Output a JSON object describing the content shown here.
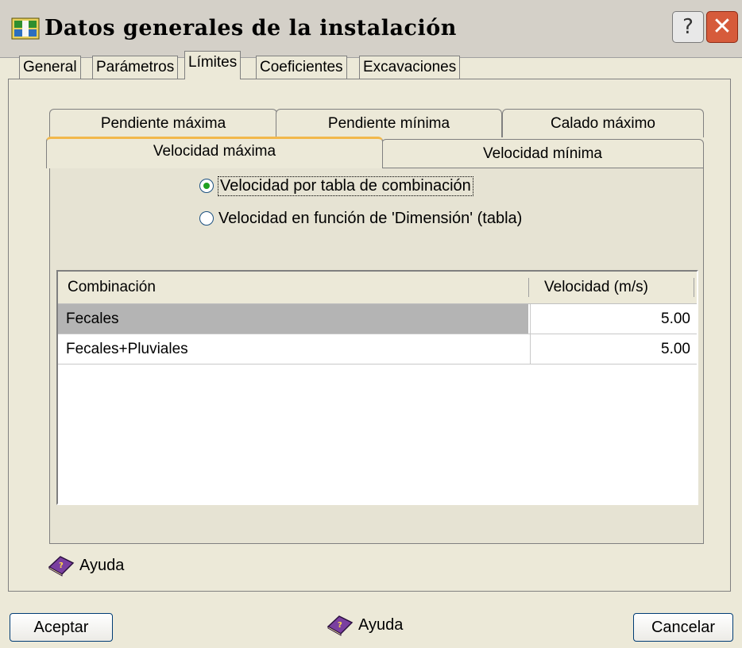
{
  "window": {
    "title": "Datos generales de la instalación",
    "help_button": "?",
    "close_button": "✕"
  },
  "top_tabs": [
    "General",
    "Parámetros",
    "Límites",
    "Coeficientes",
    "Excavaciones"
  ],
  "active_top_tab": "Límites",
  "inner_tabs_row1": [
    "Pendiente máxima",
    "Pendiente mínima",
    "Calado máximo"
  ],
  "inner_tabs_row2": [
    "Velocidad máxima",
    "Velocidad mínima"
  ],
  "active_inner_tab": "Velocidad máxima",
  "options": {
    "radio1": "Velocidad por tabla de combinación",
    "radio2": "Velocidad en función de 'Dimensión' (tabla)",
    "selected": "radio1"
  },
  "table": {
    "headers": [
      "Combinación",
      "Velocidad (m/s)"
    ],
    "rows": [
      {
        "name": "Fecales",
        "value": "5.00"
      },
      {
        "name": "Fecales+Pluviales",
        "value": "5.00"
      }
    ]
  },
  "help_inner": "Ayuda",
  "help_bottom": "Ayuda",
  "buttons": {
    "accept": "Aceptar",
    "cancel": "Cancelar"
  },
  "colors": {
    "active_tab_accent": "#f2b84b",
    "radio_dot": "#21a121",
    "close_button": "#d65b3b",
    "selected_row": "#b4b4b4"
  }
}
